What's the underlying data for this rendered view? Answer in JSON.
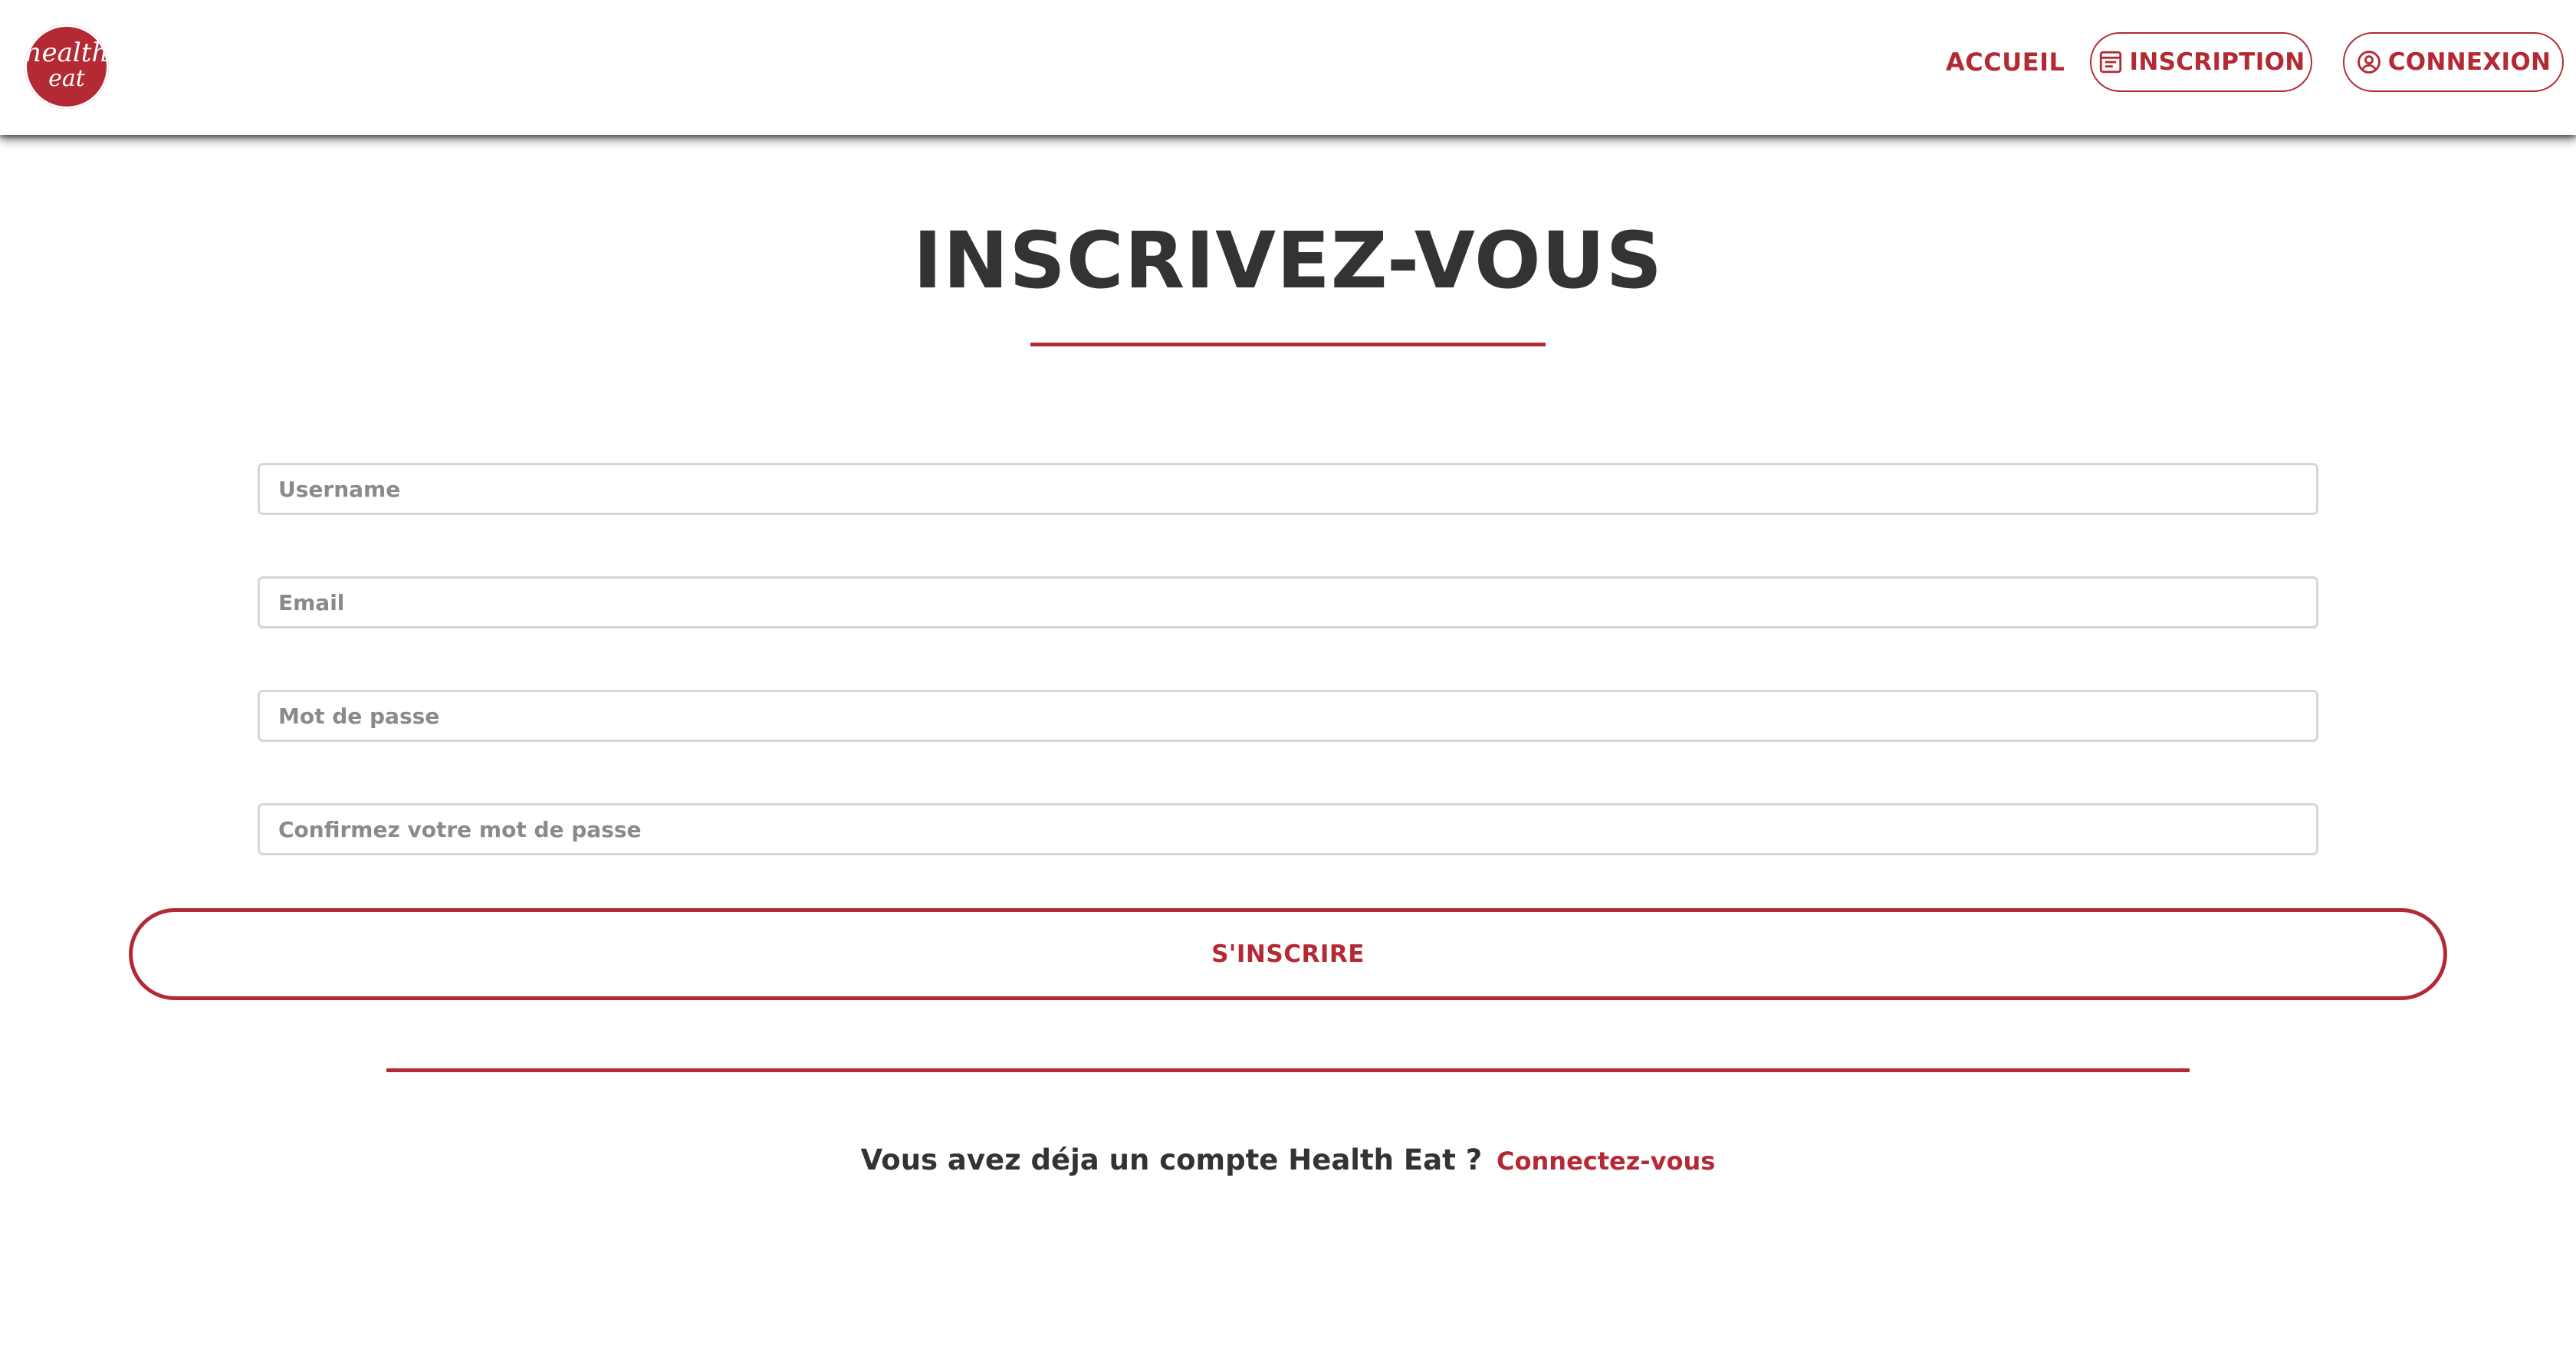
{
  "brand": {
    "logo_line1": "health",
    "logo_line2": "eat",
    "color": "#b32a35"
  },
  "nav": {
    "home_label": "ACCUEIL",
    "signup_label": "INSCRIPTION",
    "signup_icon": "form-icon",
    "login_label": "CONNEXION",
    "login_icon": "user-circle-icon"
  },
  "page": {
    "title": "INSCRIVEZ-VOUS"
  },
  "form": {
    "username_placeholder": "Username",
    "username_value": "",
    "email_placeholder": "Email",
    "email_value": "",
    "password_placeholder": "Mot de passe",
    "password_value": "",
    "confirm_placeholder": "Confirmez votre mot de passe",
    "confirm_value": "",
    "submit_label": "S'INSCRIRE"
  },
  "footer": {
    "question": "Vous avez déja un compte Health Eat ?",
    "link_label": "Connectez-vous"
  }
}
